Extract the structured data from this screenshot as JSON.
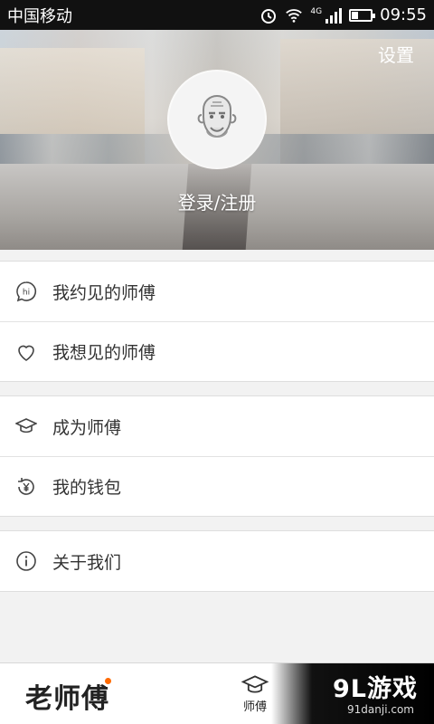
{
  "status_bar": {
    "carrier": "中国移动",
    "network": "4G",
    "time": "09:55",
    "battery_level": 0.35
  },
  "header": {
    "settings_label": "设置",
    "login_label": "登录/注册",
    "avatar_icon": "old-man-avatar-icon"
  },
  "menu": {
    "group1": [
      {
        "label": "我约见的师傅",
        "icon": "hi-bubble-icon"
      },
      {
        "label": "我想见的师傅",
        "icon": "heart-icon"
      }
    ],
    "group2": [
      {
        "label": "成为师傅",
        "icon": "graduation-cap-icon"
      },
      {
        "label": "我的钱包",
        "icon": "yuan-refresh-icon"
      }
    ],
    "group3": [
      {
        "label": "关于我们",
        "icon": "info-icon"
      }
    ]
  },
  "bottom_bar": {
    "logo_text": "老师傅",
    "tab_label": "师傅",
    "tab_icon": "graduation-cap-icon",
    "accent_color": "#ff6a00"
  },
  "watermark": {
    "title": "9L游戏",
    "url": "91danji.com"
  }
}
